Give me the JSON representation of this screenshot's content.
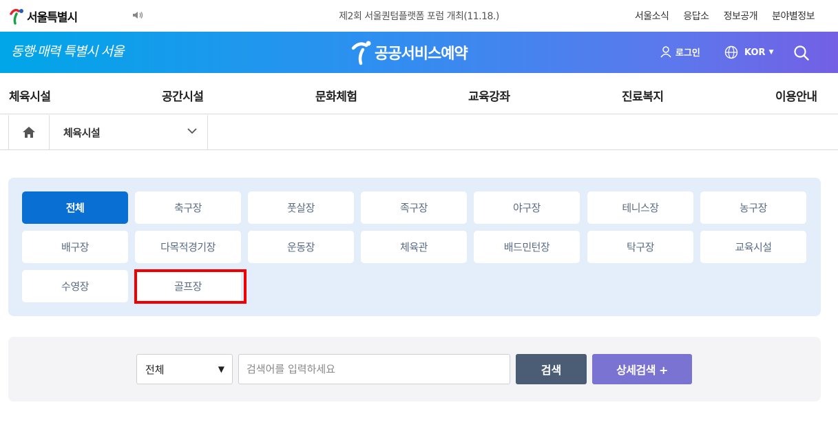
{
  "topbar": {
    "logo_text": "서울특별시",
    "notice": "제2회 서울퀀텀플랫폼 포럼 개최(11.18.)",
    "links": [
      "서울소식",
      "응답소",
      "정보공개",
      "분야별정보"
    ]
  },
  "banner": {
    "slogan": "동행·매력 특별시 서울",
    "service_title": "공공서비스예약",
    "login_label": "로그인",
    "lang_label": "KOR"
  },
  "gnb": {
    "items": [
      "체육시설",
      "공간시설",
      "문화체험",
      "교육강좌",
      "진료복지",
      "이용안내"
    ]
  },
  "breadcrumb": {
    "current": "체육시설"
  },
  "categories": {
    "items": [
      "전체",
      "축구장",
      "풋살장",
      "족구장",
      "야구장",
      "테니스장",
      "농구장",
      "배구장",
      "다목적경기장",
      "운동장",
      "체육관",
      "배드민턴장",
      "탁구장",
      "교육시설",
      "수영장",
      "골프장"
    ],
    "active": "전체",
    "highlighted": "골프장"
  },
  "search": {
    "select_value": "전체",
    "placeholder": "검색어를 입력하세요",
    "search_button": "검색",
    "detail_button": "상세검색 +"
  },
  "colors": {
    "primary": "#0a6fd3",
    "search_button": "#4a5d74",
    "detail_button": "#7a73d1",
    "highlight": "#f00000"
  }
}
